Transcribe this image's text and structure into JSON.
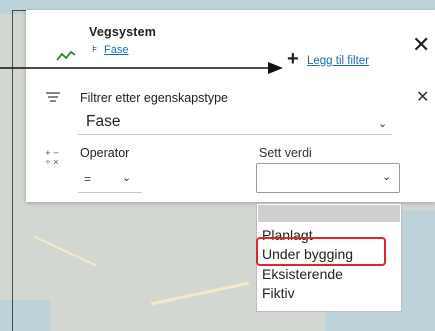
{
  "layer": {
    "title": "Vegsystem",
    "filter_chip": "Fase"
  },
  "toolbar": {
    "add_filter": "Legg til filter"
  },
  "filter": {
    "label": "Filtrer etter egenskapstype",
    "property_value": "Fase",
    "operator_label": "Operator",
    "operator_value": "=",
    "value_label": "Sett verdi",
    "value_selected": ""
  },
  "dropdown": {
    "options": [
      "",
      "Planlagt",
      "Under bygging",
      "Eksisterende",
      "Fiktiv"
    ],
    "highlighted": "Under bygging"
  },
  "colors": {
    "accent_link": "#1a6fb5",
    "highlight": "#e0252b",
    "layer_icon": "#2e8b3a"
  },
  "icons": {
    "layer": "trend-line-icon",
    "chip": "hierarchy-icon",
    "add": "plus-icon",
    "close": "close-icon",
    "filter": "filter-lines-icon",
    "operator": "plus-minus-times-icon",
    "dropdown": "chevron-down-icon"
  }
}
